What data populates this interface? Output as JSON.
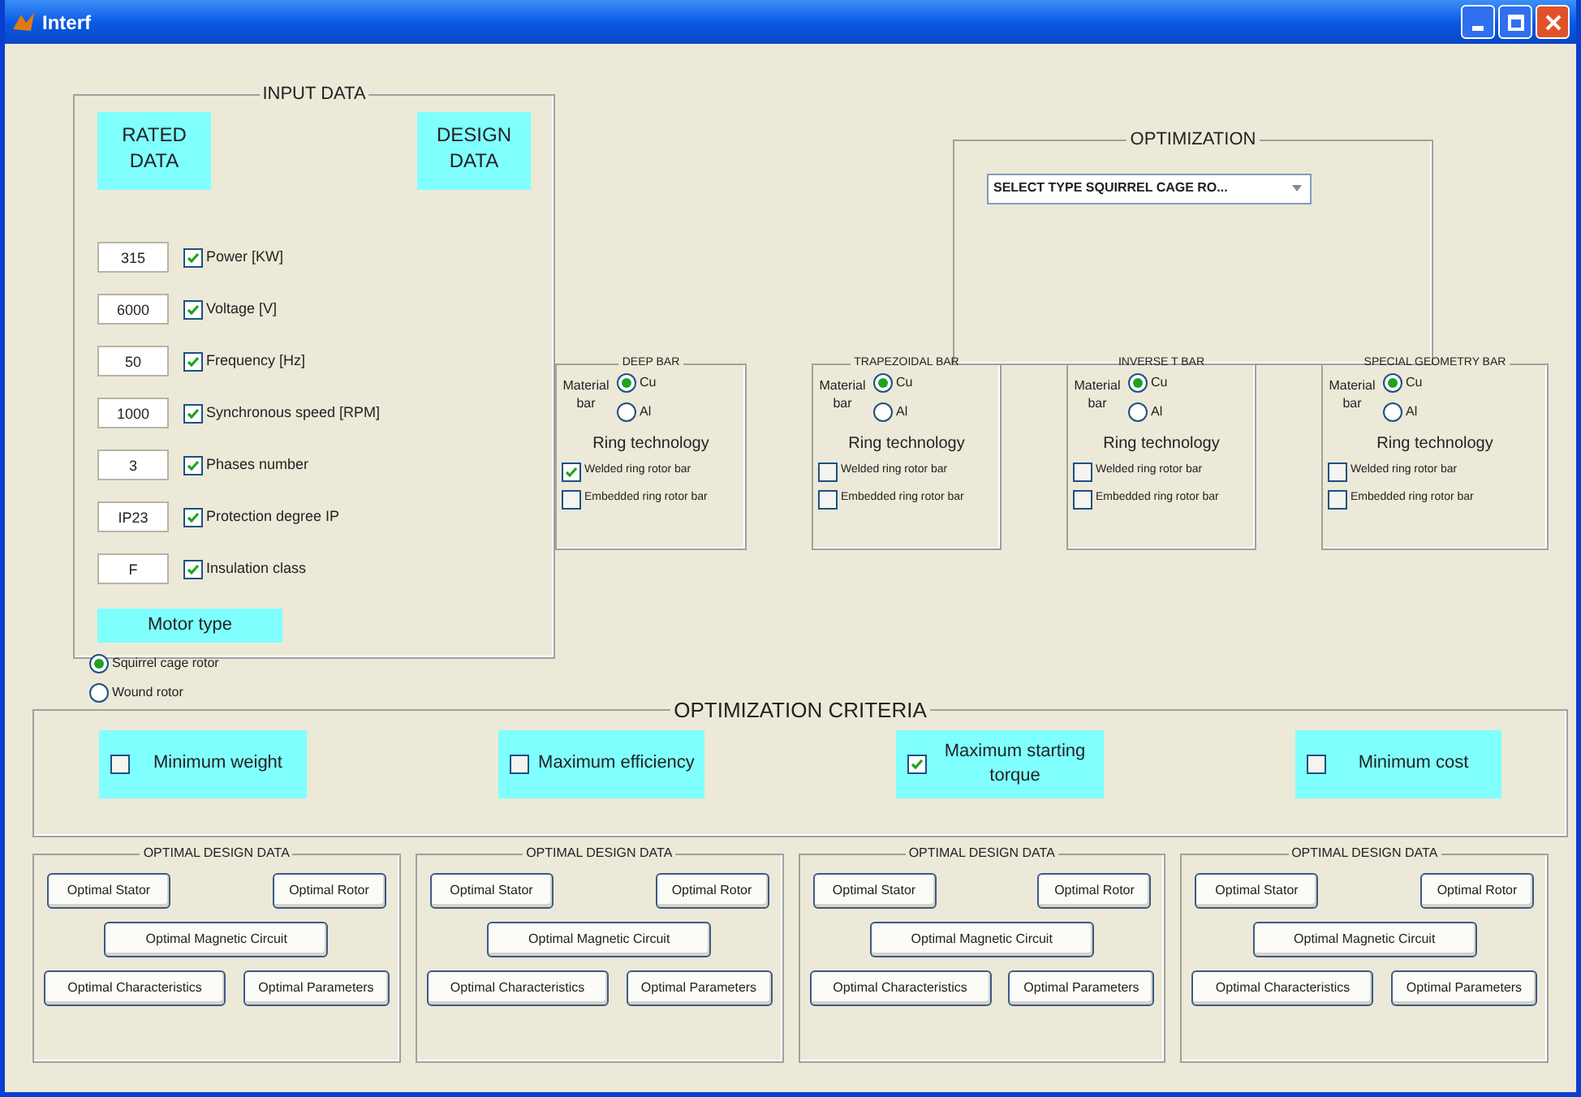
{
  "window": {
    "title": "Interf"
  },
  "input_data": {
    "title": "INPUT DATA",
    "rated_heading": "RATED DATA",
    "design_heading": "DESIGN DATA",
    "fields": [
      {
        "value": "315",
        "label": "Power [KW]",
        "checked": true
      },
      {
        "value": "6000",
        "label": "Voltage [V]",
        "checked": true
      },
      {
        "value": "50",
        "label": "Frequency [Hz]",
        "checked": true
      },
      {
        "value": "1000",
        "label": "Synchronous speed [RPM]",
        "checked": true
      },
      {
        "value": "3",
        "label": "Phases number",
        "checked": true
      },
      {
        "value": "IP23",
        "label": "Protection degree IP",
        "checked": true
      },
      {
        "value": "F",
        "label": "Insulation class",
        "checked": true
      }
    ],
    "motor_type": {
      "heading": "Motor type",
      "options": [
        {
          "label": "Squirrel cage rotor",
          "selected": true
        },
        {
          "label": "Wound rotor",
          "selected": false
        }
      ]
    }
  },
  "optimization": {
    "title": "OPTIMIZATION",
    "dropdown": {
      "value": "SELECT TYPE SQUIRREL CAGE RO..."
    }
  },
  "bars": [
    {
      "title": "DEEP BAR",
      "material_label": "Material bar",
      "materials": [
        {
          "label": "Cu",
          "selected": true
        },
        {
          "label": "Al",
          "selected": false
        }
      ],
      "ring_label": "Ring technology",
      "ring_options": [
        {
          "label": "Welded ring rotor bar",
          "checked": true
        },
        {
          "label": "Embedded ring rotor bar",
          "checked": false
        }
      ]
    },
    {
      "title": "TRAPEZOIDAL BAR",
      "material_label": "Material bar",
      "materials": [
        {
          "label": "Cu",
          "selected": true
        },
        {
          "label": "Al",
          "selected": false
        }
      ],
      "ring_label": "Ring technology",
      "ring_options": [
        {
          "label": "Welded ring rotor bar",
          "checked": false
        },
        {
          "label": "Embedded ring rotor bar",
          "checked": false
        }
      ]
    },
    {
      "title": "INVERSE T BAR",
      "material_label": "Material bar",
      "materials": [
        {
          "label": "Cu",
          "selected": true
        },
        {
          "label": "Al",
          "selected": false
        }
      ],
      "ring_label": "Ring technology",
      "ring_options": [
        {
          "label": "Welded ring rotor bar",
          "checked": false
        },
        {
          "label": "Embedded ring rotor bar",
          "checked": false
        }
      ]
    },
    {
      "title": "SPECIAL GEOMETRY BAR",
      "material_label": "Material bar",
      "materials": [
        {
          "label": "Cu",
          "selected": true
        },
        {
          "label": "Al",
          "selected": false
        }
      ],
      "ring_label": "Ring technology",
      "ring_options": [
        {
          "label": "Welded ring rotor bar",
          "checked": false
        },
        {
          "label": "Embedded ring rotor bar",
          "checked": false
        }
      ]
    }
  ],
  "criteria": {
    "title": "OPTIMIZATION CRITERIA",
    "items": [
      {
        "label": "Minimum weight",
        "checked": false
      },
      {
        "label": "Maximum efficiency",
        "checked": false
      },
      {
        "label": "Maximum starting torque",
        "checked": true
      },
      {
        "label": "Minimum cost",
        "checked": false
      }
    ]
  },
  "design_panels": [
    {
      "title": "OPTIMAL DESIGN DATA",
      "buttons": [
        "Optimal Stator",
        "Optimal Rotor",
        "Optimal Magnetic Circuit",
        "Optimal Characteristics",
        "Optimal Parameters"
      ]
    },
    {
      "title": "OPTIMAL DESIGN DATA",
      "buttons": [
        "Optimal Stator",
        "Optimal Rotor",
        "Optimal Magnetic Circuit",
        "Optimal Characteristics",
        "Optimal Parameters"
      ]
    },
    {
      "title": "OPTIMAL DESIGN DATA",
      "buttons": [
        "Optimal Stator",
        "Optimal Rotor",
        "Optimal Magnetic Circuit",
        "Optimal Characteristics",
        "Optimal Parameters"
      ]
    },
    {
      "title": "OPTIMAL DESIGN DATA",
      "buttons": [
        "Optimal Stator",
        "Optimal Rotor",
        "Optimal Magnetic Circuit",
        "Optimal Characteristics",
        "Optimal Parameters"
      ]
    }
  ]
}
